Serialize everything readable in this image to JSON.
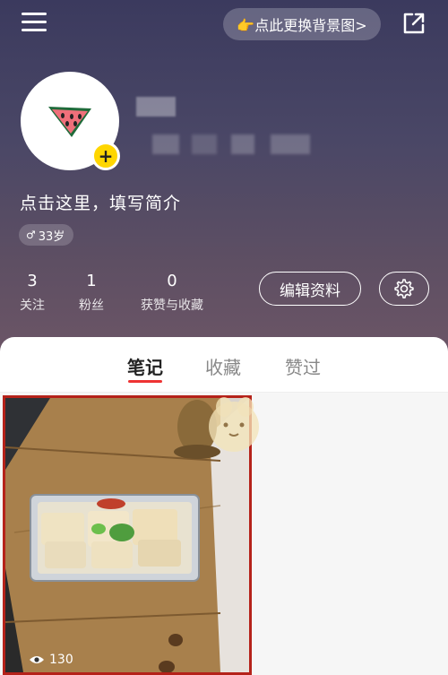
{
  "header": {
    "change_bg_label": "👉点此更换背景图>"
  },
  "profile": {
    "bio_placeholder": "点击这里，填写简介",
    "age_tag": "33岁"
  },
  "stats": [
    {
      "value": "3",
      "label": "关注"
    },
    {
      "value": "1",
      "label": "粉丝"
    },
    {
      "value": "0",
      "label": "获赞与收藏"
    }
  ],
  "actions": {
    "edit_profile": "编辑资料"
  },
  "tabs": [
    {
      "label": "笔记",
      "active": true
    },
    {
      "label": "收藏",
      "active": false
    },
    {
      "label": "赞过",
      "active": false
    }
  ],
  "notes": [
    {
      "views": "130"
    }
  ],
  "colors": {
    "accent": "#e33333",
    "highlight": "#b5221a",
    "plus_badge": "#ffd600"
  }
}
